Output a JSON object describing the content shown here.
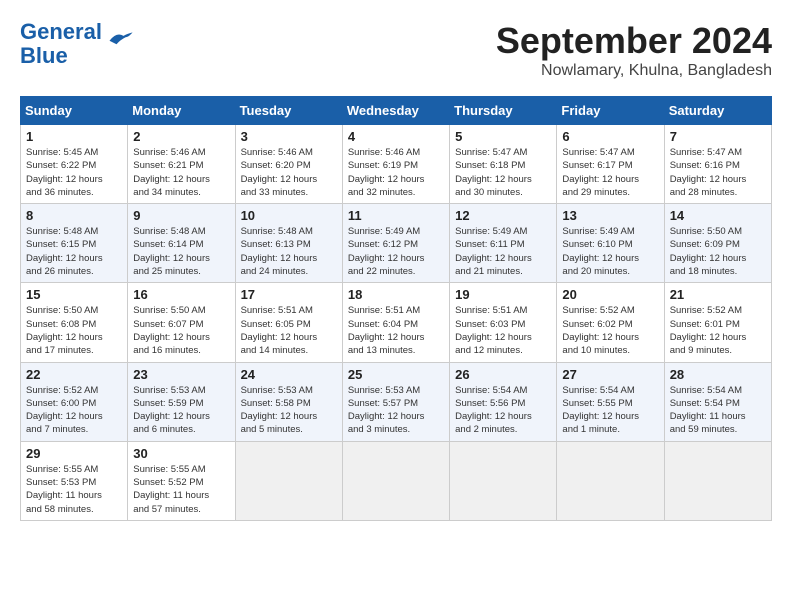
{
  "header": {
    "logo_line1": "General",
    "logo_line2": "Blue",
    "month": "September 2024",
    "location": "Nowlamary, Khulna, Bangladesh"
  },
  "weekdays": [
    "Sunday",
    "Monday",
    "Tuesday",
    "Wednesday",
    "Thursday",
    "Friday",
    "Saturday"
  ],
  "weeks": [
    [
      {
        "day": "1",
        "text": "Sunrise: 5:45 AM\nSunset: 6:22 PM\nDaylight: 12 hours\nand 36 minutes."
      },
      {
        "day": "2",
        "text": "Sunrise: 5:46 AM\nSunset: 6:21 PM\nDaylight: 12 hours\nand 34 minutes."
      },
      {
        "day": "3",
        "text": "Sunrise: 5:46 AM\nSunset: 6:20 PM\nDaylight: 12 hours\nand 33 minutes."
      },
      {
        "day": "4",
        "text": "Sunrise: 5:46 AM\nSunset: 6:19 PM\nDaylight: 12 hours\nand 32 minutes."
      },
      {
        "day": "5",
        "text": "Sunrise: 5:47 AM\nSunset: 6:18 PM\nDaylight: 12 hours\nand 30 minutes."
      },
      {
        "day": "6",
        "text": "Sunrise: 5:47 AM\nSunset: 6:17 PM\nDaylight: 12 hours\nand 29 minutes."
      },
      {
        "day": "7",
        "text": "Sunrise: 5:47 AM\nSunset: 6:16 PM\nDaylight: 12 hours\nand 28 minutes."
      }
    ],
    [
      {
        "day": "8",
        "text": "Sunrise: 5:48 AM\nSunset: 6:15 PM\nDaylight: 12 hours\nand 26 minutes."
      },
      {
        "day": "9",
        "text": "Sunrise: 5:48 AM\nSunset: 6:14 PM\nDaylight: 12 hours\nand 25 minutes."
      },
      {
        "day": "10",
        "text": "Sunrise: 5:48 AM\nSunset: 6:13 PM\nDaylight: 12 hours\nand 24 minutes."
      },
      {
        "day": "11",
        "text": "Sunrise: 5:49 AM\nSunset: 6:12 PM\nDaylight: 12 hours\nand 22 minutes."
      },
      {
        "day": "12",
        "text": "Sunrise: 5:49 AM\nSunset: 6:11 PM\nDaylight: 12 hours\nand 21 minutes."
      },
      {
        "day": "13",
        "text": "Sunrise: 5:49 AM\nSunset: 6:10 PM\nDaylight: 12 hours\nand 20 minutes."
      },
      {
        "day": "14",
        "text": "Sunrise: 5:50 AM\nSunset: 6:09 PM\nDaylight: 12 hours\nand 18 minutes."
      }
    ],
    [
      {
        "day": "15",
        "text": "Sunrise: 5:50 AM\nSunset: 6:08 PM\nDaylight: 12 hours\nand 17 minutes."
      },
      {
        "day": "16",
        "text": "Sunrise: 5:50 AM\nSunset: 6:07 PM\nDaylight: 12 hours\nand 16 minutes."
      },
      {
        "day": "17",
        "text": "Sunrise: 5:51 AM\nSunset: 6:05 PM\nDaylight: 12 hours\nand 14 minutes."
      },
      {
        "day": "18",
        "text": "Sunrise: 5:51 AM\nSunset: 6:04 PM\nDaylight: 12 hours\nand 13 minutes."
      },
      {
        "day": "19",
        "text": "Sunrise: 5:51 AM\nSunset: 6:03 PM\nDaylight: 12 hours\nand 12 minutes."
      },
      {
        "day": "20",
        "text": "Sunrise: 5:52 AM\nSunset: 6:02 PM\nDaylight: 12 hours\nand 10 minutes."
      },
      {
        "day": "21",
        "text": "Sunrise: 5:52 AM\nSunset: 6:01 PM\nDaylight: 12 hours\nand 9 minutes."
      }
    ],
    [
      {
        "day": "22",
        "text": "Sunrise: 5:52 AM\nSunset: 6:00 PM\nDaylight: 12 hours\nand 7 minutes."
      },
      {
        "day": "23",
        "text": "Sunrise: 5:53 AM\nSunset: 5:59 PM\nDaylight: 12 hours\nand 6 minutes."
      },
      {
        "day": "24",
        "text": "Sunrise: 5:53 AM\nSunset: 5:58 PM\nDaylight: 12 hours\nand 5 minutes."
      },
      {
        "day": "25",
        "text": "Sunrise: 5:53 AM\nSunset: 5:57 PM\nDaylight: 12 hours\nand 3 minutes."
      },
      {
        "day": "26",
        "text": "Sunrise: 5:54 AM\nSunset: 5:56 PM\nDaylight: 12 hours\nand 2 minutes."
      },
      {
        "day": "27",
        "text": "Sunrise: 5:54 AM\nSunset: 5:55 PM\nDaylight: 12 hours\nand 1 minute."
      },
      {
        "day": "28",
        "text": "Sunrise: 5:54 AM\nSunset: 5:54 PM\nDaylight: 11 hours\nand 59 minutes."
      }
    ],
    [
      {
        "day": "29",
        "text": "Sunrise: 5:55 AM\nSunset: 5:53 PM\nDaylight: 11 hours\nand 58 minutes."
      },
      {
        "day": "30",
        "text": "Sunrise: 5:55 AM\nSunset: 5:52 PM\nDaylight: 11 hours\nand 57 minutes."
      },
      {
        "day": "",
        "text": ""
      },
      {
        "day": "",
        "text": ""
      },
      {
        "day": "",
        "text": ""
      },
      {
        "day": "",
        "text": ""
      },
      {
        "day": "",
        "text": ""
      }
    ]
  ]
}
